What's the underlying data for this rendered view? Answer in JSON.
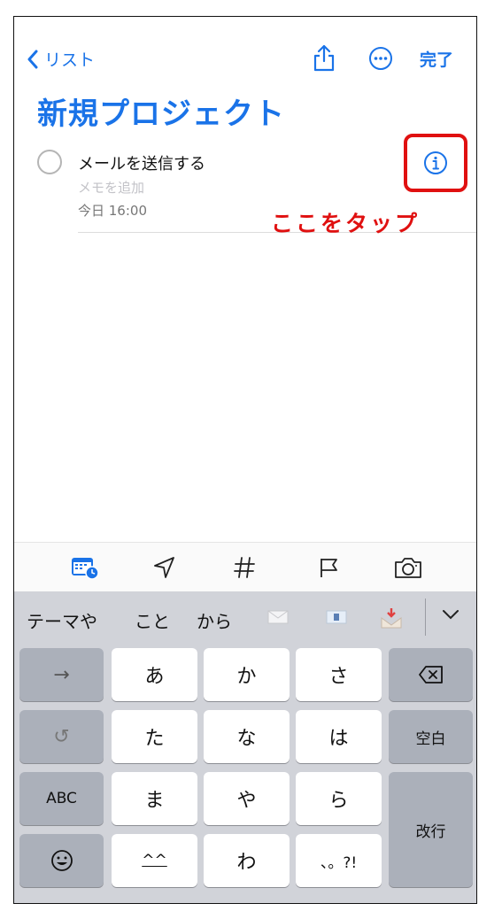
{
  "nav": {
    "back_label": "リスト",
    "done_label": "完了"
  },
  "list_title": "新規プロジェクト",
  "task": {
    "title": "メールを送信する",
    "note_placeholder": "メモを追加",
    "due": "今日 16:00"
  },
  "annotation": {
    "text": "ここをタップ",
    "color": "#e01010"
  },
  "toolbar": {
    "icons": [
      "calendar-clock-icon",
      "location-arrow-icon",
      "hashtag-icon",
      "flag-icon",
      "camera-icon"
    ]
  },
  "keyboard": {
    "predictions": [
      "テーマや",
      "こと",
      "から"
    ],
    "prediction_emojis": [
      "envelope-icon",
      "envelope-e-icon",
      "inbox-tray-icon"
    ],
    "keys": {
      "arrow": "→",
      "a": "あ",
      "ka": "か",
      "sa": "さ",
      "ta": "た",
      "na": "な",
      "ha": "は",
      "space": "空白",
      "undo": "↺",
      "abc": "ABC",
      "ma": "ま",
      "ya": "や",
      "ra": "ら",
      "return": "改行",
      "emoticon": "^^",
      "wa": "わ",
      "punct": "、。?!"
    }
  },
  "colors": {
    "accent": "#1a73e8",
    "keyboard_bg": "#d1d3d9",
    "special_key": "#abb0ba"
  }
}
